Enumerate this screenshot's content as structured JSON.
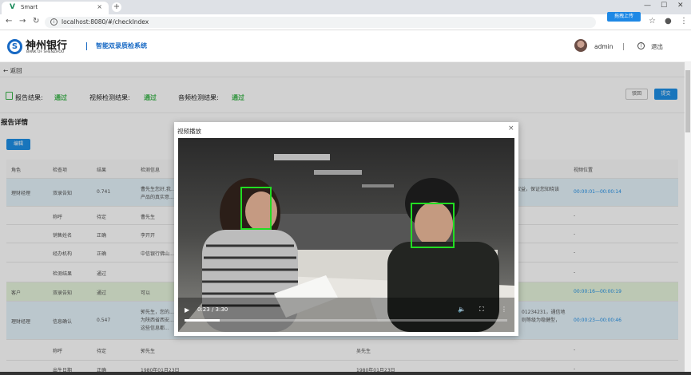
{
  "browser": {
    "tab_title": "Smart",
    "url": "localhost:8080/#/checkIndex",
    "extension_upload_label": "拖拽上传"
  },
  "header": {
    "bank_name_cn": "神州银行",
    "bank_name_en": "BANK OF SHENZHOU",
    "system_title": "智能双录质检系统",
    "user": "admin",
    "logout_label": "退出"
  },
  "page": {
    "back_label": "返回",
    "report_result_label": "报告结果:",
    "report_result_value": "通过",
    "video_result_label": "视频检测结果:",
    "video_result_value": "通过",
    "audio_result_label": "音频检测结果:",
    "audio_result_value": "通过",
    "reject_label": "驳回",
    "submit_label": "提交",
    "detail_title": "报告详情",
    "edit_label": "编辑"
  },
  "table": {
    "headers": [
      "角色",
      "检查项",
      "结果",
      "检测信息",
      "视频位置"
    ],
    "rows": [
      {
        "role": "理财经理",
        "item": "双录告知",
        "result": "0.741",
        "info": "曹先生您好,我...",
        "info2": "产品的真实意...",
        "right": "权益，保证您知晓该",
        "pos": "00:00:01—00:00:14"
      },
      {
        "role": "",
        "item": "称呼",
        "result": "待定",
        "info": "曹先生",
        "info2": "",
        "right": "",
        "pos": "-"
      },
      {
        "role": "",
        "item": "销售姓名",
        "result": "正确",
        "info": "李开开",
        "info2": "",
        "right": "",
        "pos": "-"
      },
      {
        "role": "",
        "item": "经办机构",
        "result": "正确",
        "info": "中信银行佛山...",
        "info2": "",
        "right": "",
        "pos": "-"
      },
      {
        "role": "",
        "item": "检测结果",
        "result": "通过",
        "info": "",
        "info2": "",
        "right": "",
        "pos": "-"
      },
      {
        "role": "客户",
        "item": "双录告知",
        "result": "通过",
        "info": "可以",
        "info2": "",
        "right": "",
        "pos": "00:00:16—00:00:19"
      },
      {
        "role": "理财经理",
        "item": "信息确认",
        "result": "0.547",
        "info": "郭先生，您的...",
        "info2": "为陕西省西安...",
        "right": "01234231，通信地",
        "pos": "00:00:23—00:00:46"
      },
      {
        "role": "",
        "item": "称呼",
        "result": "待定",
        "info": "郭先生",
        "info2": "",
        "right": "吴先生",
        "pos": "-"
      },
      {
        "role": "",
        "item": "出生日期",
        "result": "正确",
        "info": "1980年01月23日",
        "info2": "",
        "right": "1980年01月23日",
        "pos": "-"
      }
    ],
    "row6_extra": "这些信息都...",
    "row6_right2": "则等级为稳健型，"
  },
  "dialog": {
    "title": "视频播放",
    "time": "0:23 / 3:30",
    "progress": 0.11
  },
  "colors": {
    "accent": "#1e8fe6",
    "pass_green": "#3ab54a",
    "highlight_blue": "#e5f3fb",
    "highlight_green": "#e6f4dc"
  }
}
